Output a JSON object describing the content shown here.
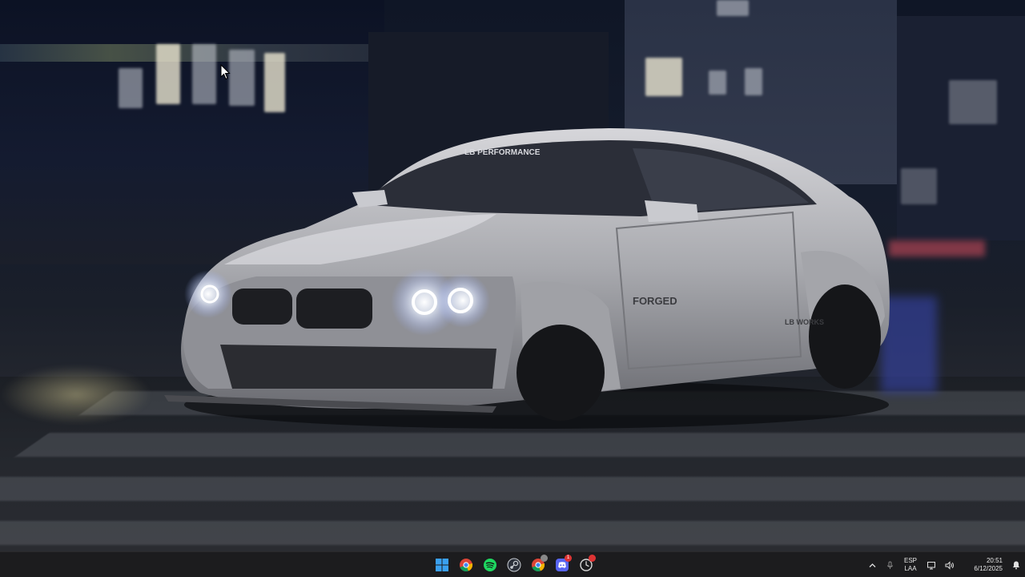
{
  "desktop": {
    "wallpaper": "night city street with white wide-body sports coupe drifting",
    "car_windshield_text": "LB PERFORMANCE",
    "car_side_texts": [
      "FORGED",
      "LB WORKS"
    ]
  },
  "taskbar": {
    "apps": [
      {
        "name": "start",
        "icon": "windows-logo-icon"
      },
      {
        "name": "chrome",
        "icon": "chrome-icon"
      },
      {
        "name": "spotify",
        "icon": "spotify-icon"
      },
      {
        "name": "steam",
        "icon": "steam-icon"
      },
      {
        "name": "chrome-profile",
        "icon": "chrome-icon"
      },
      {
        "name": "discord",
        "icon": "discord-icon",
        "badge": "1"
      },
      {
        "name": "clock-app",
        "icon": "clock-icon"
      }
    ],
    "tray": {
      "language_line1": "ESP",
      "language_line2": "LAA",
      "time": "20:51",
      "date": "6/12/2025"
    }
  },
  "colors": {
    "taskbar_bg": "#1c1c1e",
    "accent_blue": "#3aa0f0",
    "spotify_green": "#1ed760",
    "discord_blurple": "#5865f2"
  }
}
